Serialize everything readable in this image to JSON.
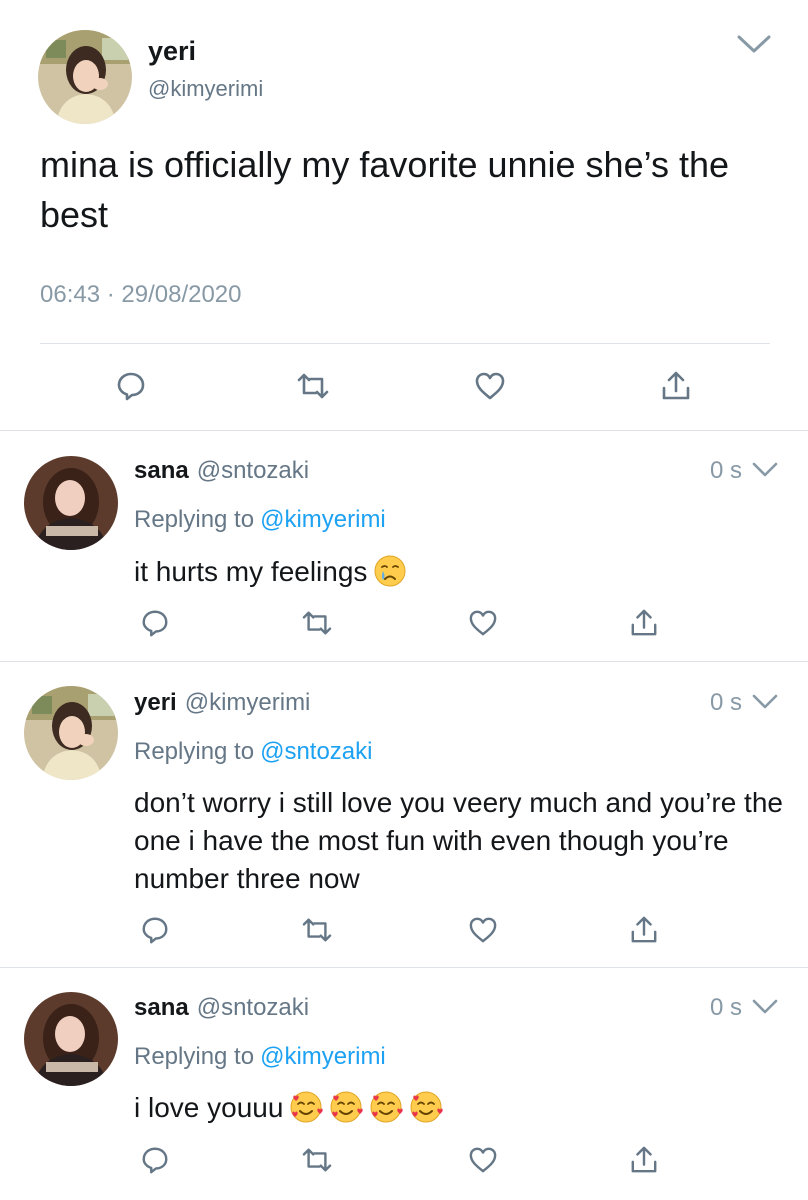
{
  "main_tweet": {
    "name": "yeri",
    "handle": "@kimyerimi",
    "text": "mina is officially my favorite unnie she’s the best",
    "timestamp": "06:43 · 29/08/2020"
  },
  "replies": [
    {
      "name": "sana",
      "handle": "@sntozaki",
      "time": "0 s",
      "replying_label": "Replying to",
      "replying_to": "@kimyerimi",
      "text": "it hurts my feelings",
      "emoji": [
        "crying-face"
      ]
    },
    {
      "name": "yeri",
      "handle": "@kimyerimi",
      "time": "0 s",
      "replying_label": "Replying to",
      "replying_to": "@sntozaki",
      "text": "don’t worry i still love you veery much and you’re the one i have the most fun with even though you’re number three now",
      "emoji": []
    },
    {
      "name": "sana",
      "handle": "@sntozaki",
      "time": "0 s",
      "replying_label": "Replying to",
      "replying_to": "@kimyerimi",
      "text": "i love youuu",
      "emoji": [
        "smiling-face-with-hearts",
        "smiling-face-with-hearts",
        "smiling-face-with-hearts",
        "smiling-face-with-hearts"
      ]
    }
  ],
  "icons": [
    "chevron-down-icon",
    "reply-icon",
    "retweet-icon",
    "like-icon",
    "share-icon"
  ],
  "colors": {
    "link": "#1da1f2",
    "secondary_text": "#657786",
    "icon": "#657786",
    "divider": "#dfe3e7"
  }
}
